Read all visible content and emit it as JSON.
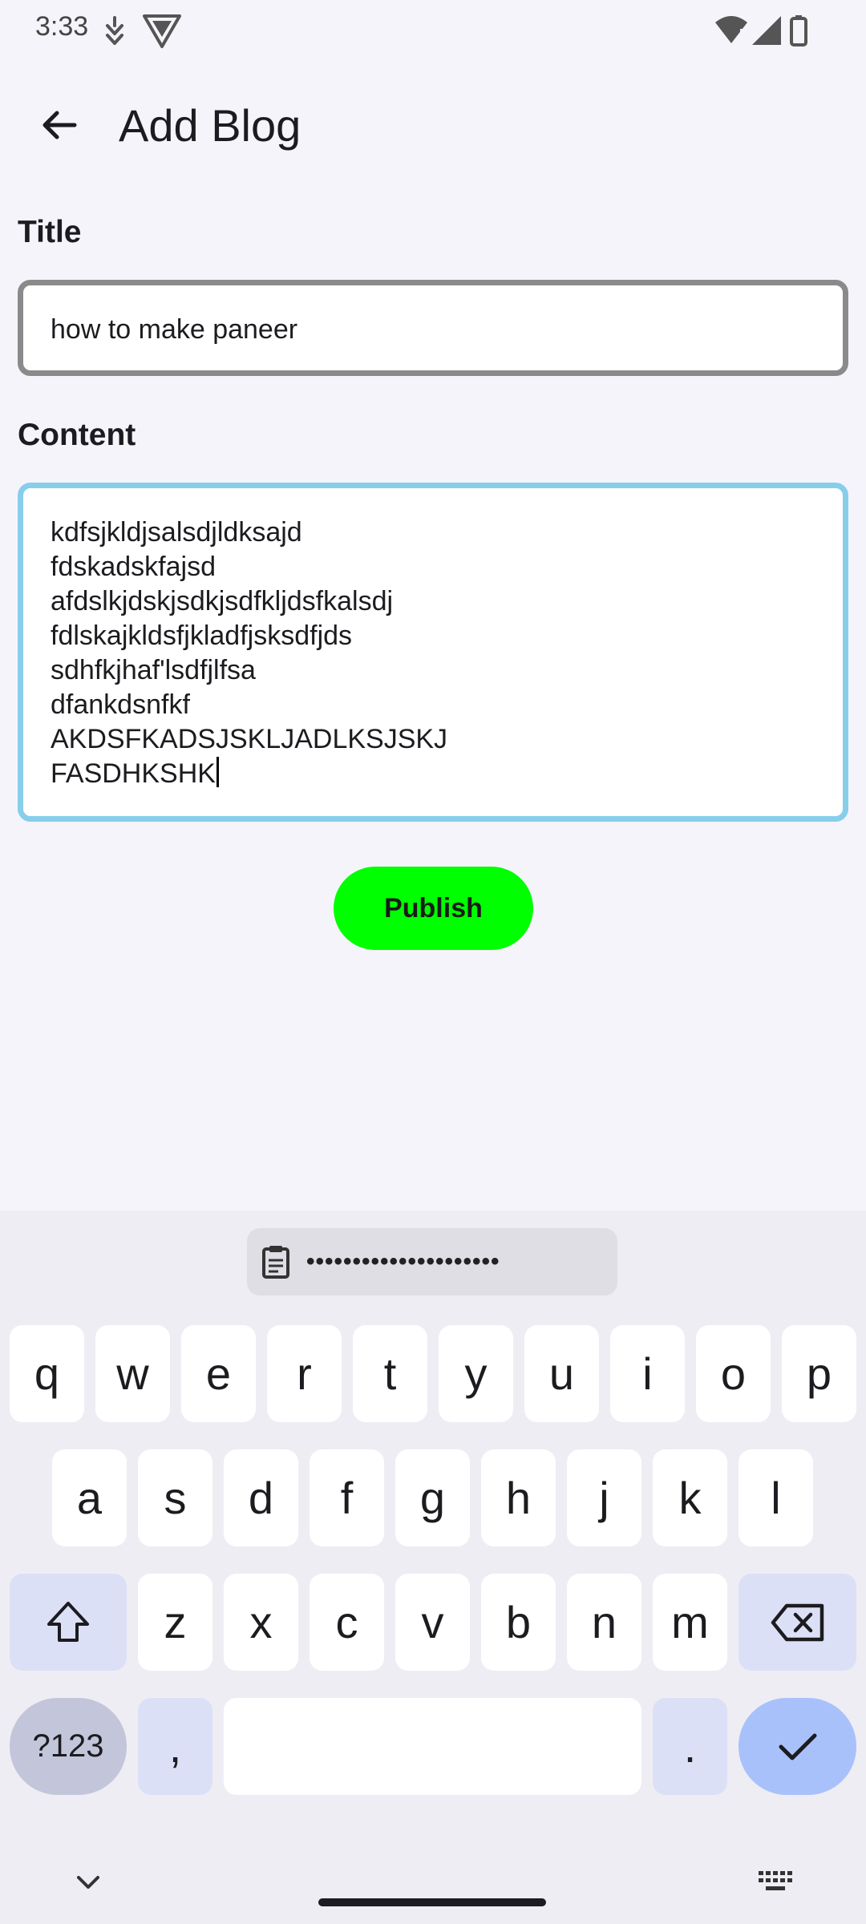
{
  "status_bar": {
    "time": "3:33",
    "icons": [
      "notification-icon",
      "vpn-shield-icon",
      "wifi-warning-icon",
      "signal-icon",
      "battery-icon"
    ]
  },
  "app_bar": {
    "back_icon": "arrow-back-icon",
    "title": "Add Blog"
  },
  "form": {
    "title_label": "Title",
    "title_value": "how to make paneer",
    "content_label": "Content",
    "content_lines": [
      "kdfsjkldjsalsdjldksajd",
      "fdskadskfajsd",
      "afdslkjdskjsdkjsdfkljdsfkalsdj",
      "fdlskajkldsfjkladfjsksdfjds",
      "sdhfkjhaf'lsdfjlfsa",
      "dfankdsnfkf",
      "AKDSFKADSJSKLJADLKSJSKJ",
      "FASDHKSHK"
    ],
    "publish_label": "Publish",
    "colors": {
      "title_border": "#8a8a8a",
      "content_border_focused": "#87ceeb",
      "publish_bg": "#00ff00"
    }
  },
  "keyboard": {
    "clipboard_text": "•••••••••••••••••••••",
    "row1": [
      "q",
      "w",
      "e",
      "r",
      "t",
      "y",
      "u",
      "i",
      "o",
      "p"
    ],
    "row2": [
      "a",
      "s",
      "d",
      "f",
      "g",
      "h",
      "j",
      "k",
      "l"
    ],
    "row3": [
      "z",
      "x",
      "c",
      "v",
      "b",
      "n",
      "m"
    ],
    "symbols_label": "?123",
    "comma_label": ",",
    "period_label": ".",
    "shift_icon": "shift-icon",
    "backspace_icon": "backspace-icon",
    "enter_icon": "check-icon",
    "hide_icon": "chevron-down-icon",
    "switch_icon": "keyboard-icon"
  }
}
